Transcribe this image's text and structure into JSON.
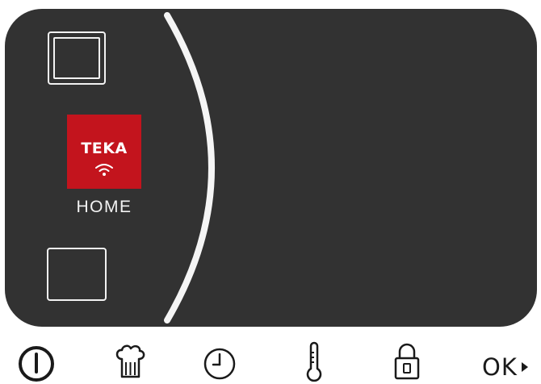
{
  "brand": {
    "name": "TEKA",
    "sub_label": "HOME",
    "color": "#c3141d"
  },
  "display": {
    "background": "#323232",
    "foreground": "#f2f2f2"
  },
  "controls": {
    "power": "power-icon",
    "chef": "chef-hat-icon",
    "timer": "clock-icon",
    "temperature": "thermometer-icon",
    "lock": "lock-icon",
    "ok_label": "OK"
  }
}
